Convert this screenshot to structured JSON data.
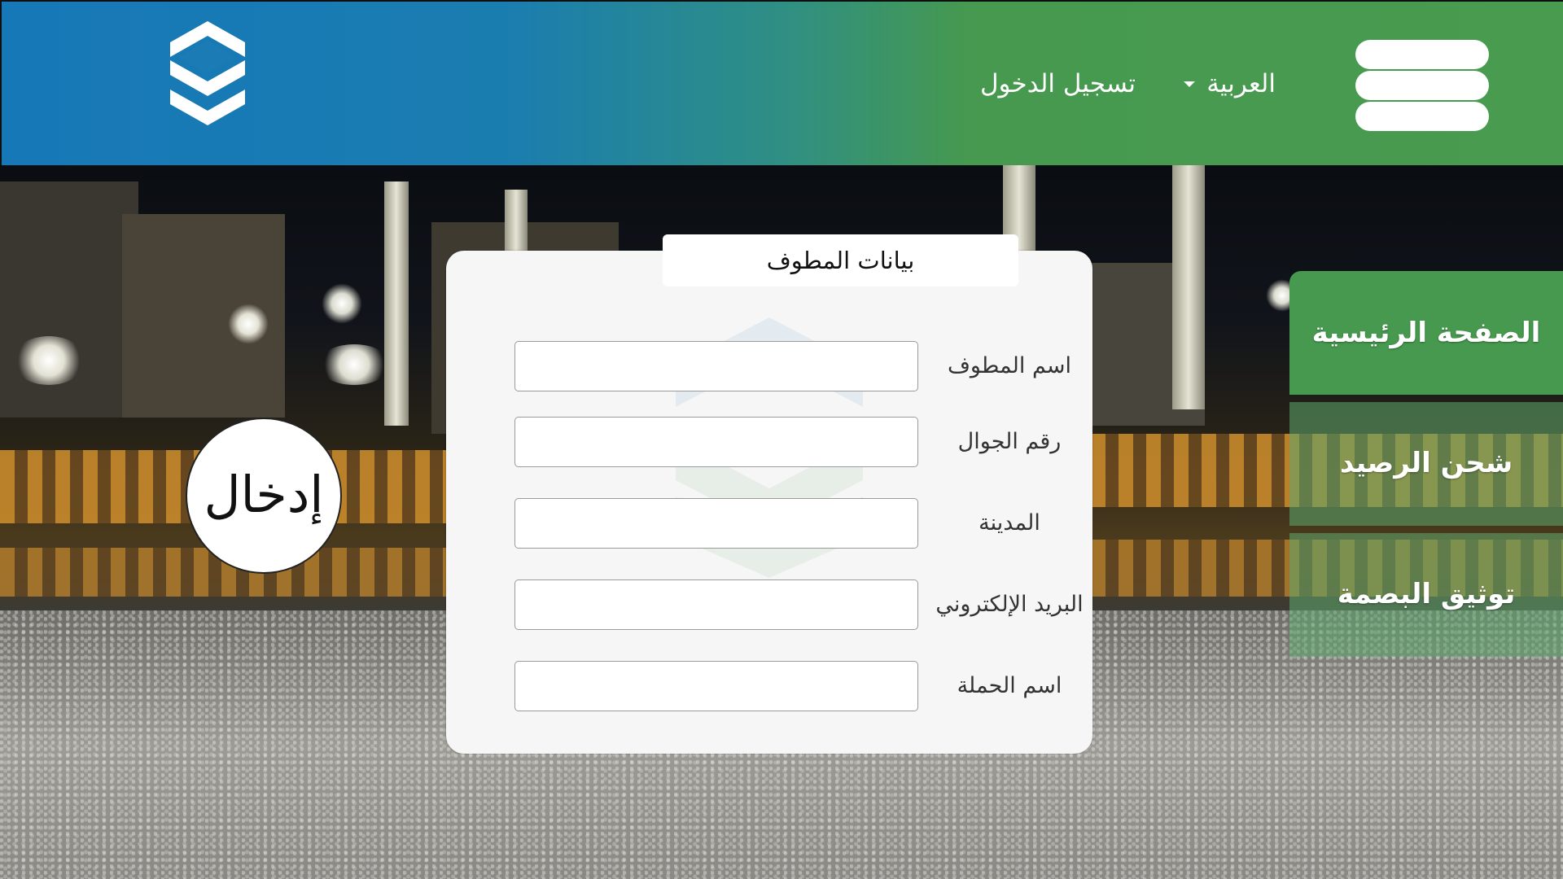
{
  "header": {
    "logo_icon": "stacked-chevrons-logo-icon",
    "language_label": "العربية",
    "login_label": "تسجيل الدخول",
    "menu_icon": "hamburger-menu-icon"
  },
  "form": {
    "title": "بيانات المطوف",
    "fields": [
      {
        "label": "اسم المطوف",
        "value": "",
        "placeholder": ""
      },
      {
        "label": "رقم الجوال",
        "value": "",
        "placeholder": ""
      },
      {
        "label": "المدينة",
        "value": "",
        "placeholder": ""
      },
      {
        "label": "البريد الإلكتروني",
        "value": "",
        "placeholder": ""
      },
      {
        "label": "اسم الحملة",
        "value": "",
        "placeholder": ""
      }
    ],
    "submit_label": "إدخال"
  },
  "side_menu": {
    "items": [
      {
        "label": "الصفحة الرئيسية",
        "active": true
      },
      {
        "label": "شحن الرصيد",
        "active": false
      },
      {
        "label": "توثيق البصمة",
        "active": false
      }
    ]
  },
  "colors": {
    "header_blue": "#1778b8",
    "header_green": "#489b4f",
    "menu_green": "#46994f",
    "card_bg": "#f6f6f6"
  }
}
